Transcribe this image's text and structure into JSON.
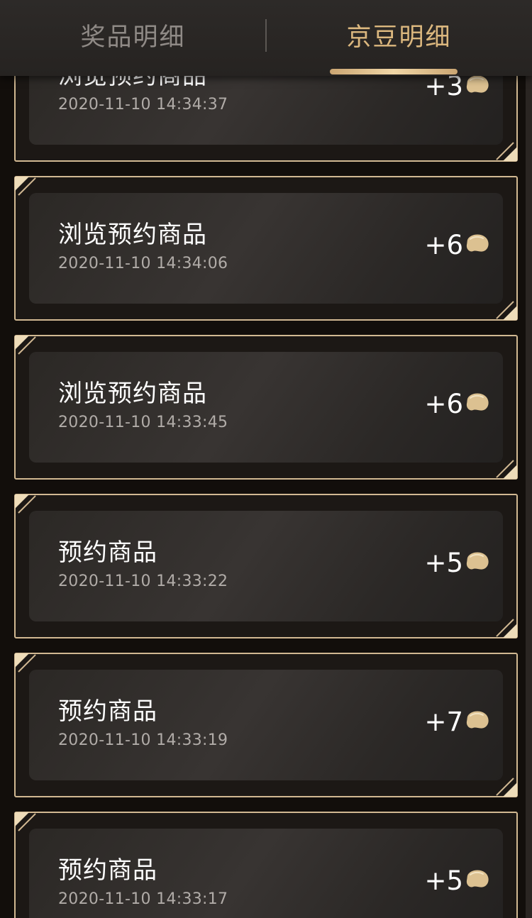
{
  "tabs": [
    {
      "label": "奖品明细",
      "active": false
    },
    {
      "label": "京豆明细",
      "active": true
    }
  ],
  "colors": {
    "accent": "#dbb77e",
    "card_border": "#d1b892",
    "background": "#120e0b"
  },
  "icons": {
    "bean": "jd-bean-icon"
  },
  "records": [
    {
      "title": "浏览预约商品",
      "time": "2020-11-10 14:34:37",
      "points": "+3"
    },
    {
      "title": "浏览预约商品",
      "time": "2020-11-10 14:34:06",
      "points": "+6"
    },
    {
      "title": "浏览预约商品",
      "time": "2020-11-10 14:33:45",
      "points": "+6"
    },
    {
      "title": "预约商品",
      "time": "2020-11-10 14:33:22",
      "points": "+5"
    },
    {
      "title": "预约商品",
      "time": "2020-11-10 14:33:19",
      "points": "+7"
    },
    {
      "title": "预约商品",
      "time": "2020-11-10 14:33:17",
      "points": "+5"
    }
  ]
}
